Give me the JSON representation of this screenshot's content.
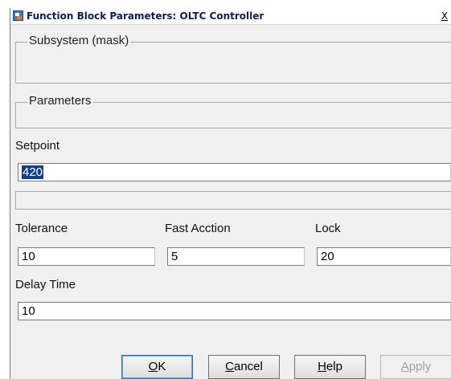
{
  "window": {
    "title": "Function Block Parameters: OLTC Controller",
    "close_label": "X"
  },
  "groups": {
    "subsystem_title": "Subsystem (mask)",
    "parameters_title": "Parameters"
  },
  "fields": {
    "setpoint": {
      "label": "Setpoint",
      "value": "420"
    },
    "tolerance": {
      "label": "Tolerance",
      "value": "10"
    },
    "fast_action": {
      "label": "Fast Acction",
      "value": "5"
    },
    "lock": {
      "label": "Lock",
      "value": "20"
    },
    "delay_time": {
      "label": "Delay Time",
      "value": "10"
    }
  },
  "buttons": {
    "ok": {
      "mnemonic": "O",
      "rest": "K"
    },
    "cancel": {
      "mnemonic": "C",
      "rest": "ancel"
    },
    "help": {
      "mnemonic": "H",
      "rest": "elp"
    },
    "apply": {
      "mnemonic": "A",
      "rest": "pply"
    }
  },
  "colors": {
    "title_text": "#0e1f57",
    "selection": "#103f8f",
    "window_bg": "#f0f0f0"
  },
  "icons": {
    "app": "simulink-block-icon",
    "close": "close-icon"
  }
}
